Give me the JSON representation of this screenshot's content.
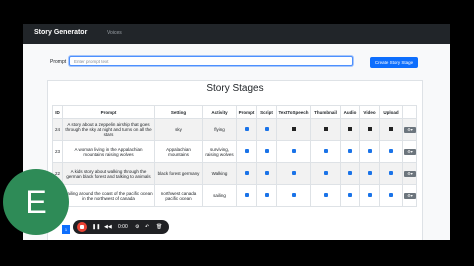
{
  "nav": {
    "brand": "Story Generator",
    "link": "Voices"
  },
  "form": {
    "prompt_label": "Prompt",
    "prompt_placeholder": "Enter prompt text",
    "create_label": "Create Story Stage"
  },
  "card": {
    "title": "Story Stages"
  },
  "table": {
    "headers": [
      "ID",
      "Prompt",
      "Setting",
      "Activity",
      "Prompt",
      "Script",
      "TextToSpeech",
      "Thumbnail",
      "Audio",
      "Video",
      "Upload",
      ""
    ],
    "rows": [
      {
        "id": "24",
        "prompt": "A story about a zeppelin airship that goes through the sky at night and turns on all the stars",
        "setting": "sky",
        "activity": "flying"
      },
      {
        "id": "23",
        "prompt": "A woman living in the Appalachian mountains raising wolves",
        "setting": "Appalachian mountains",
        "activity": "surviving, raising wolves"
      },
      {
        "id": "22",
        "prompt": "A kids story about walking through the german black forest and talking to animals",
        "setting": "black forest germany",
        "activity": "Walking"
      },
      {
        "id": "",
        "prompt": "Sailing around the coast of the pacific ocean in the northwest of canada",
        "setting": "northwest canada pacific ocean",
        "activity": "sailing"
      }
    ]
  },
  "overlay": {
    "avatar_letter": "E",
    "page_number": "1",
    "timer": "0:00",
    "play": "❚❚",
    "rewind": "◀◀",
    "stop_color": "#ea4335"
  },
  "colors": {
    "primary": "#0d6efd",
    "avatar": "#2e8b57",
    "navbar": "#212529"
  }
}
